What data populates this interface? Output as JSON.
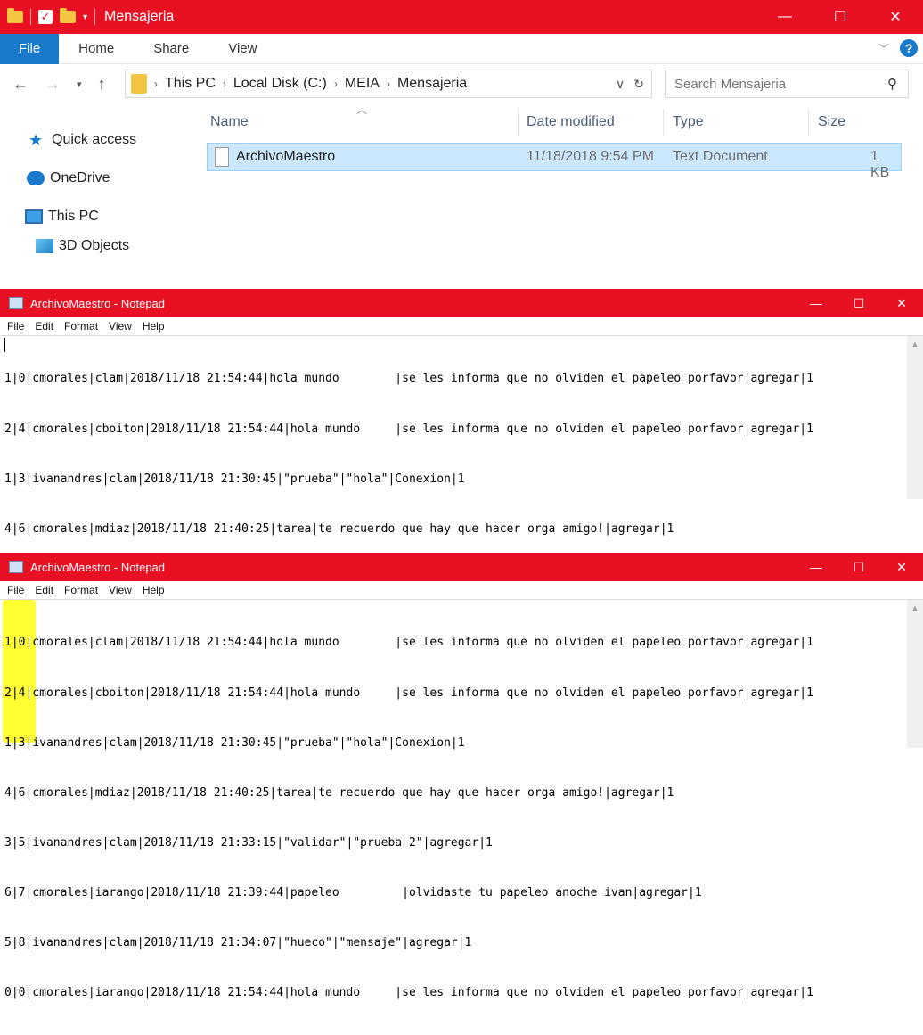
{
  "explorer": {
    "title": "Mensajeria",
    "window_controls": [
      "—",
      "☐",
      "✕"
    ],
    "ribbon_tabs": [
      "File",
      "Home",
      "Share",
      "View"
    ],
    "breadcrumb": [
      "This PC",
      "Local Disk (C:)",
      "MEIA",
      "Mensajeria"
    ],
    "search_placeholder": "Search Mensajeria",
    "nav": [
      "Quick access",
      "OneDrive",
      "This PC",
      "3D Objects"
    ],
    "columns": [
      "Name",
      "Date modified",
      "Type",
      "Size"
    ],
    "file": {
      "name": "ArchivoMaestro",
      "date": "11/18/2018 9:54 PM",
      "type": "Text Document",
      "size": "1 KB"
    }
  },
  "notepad": {
    "title": "ArchivoMaestro - Notepad",
    "menu": [
      "File",
      "Edit",
      "Format",
      "View",
      "Help"
    ],
    "lines": [
      "1|0|cmorales|clam|2018/11/18 21:54:44|hola mundo        |se les informa que no olviden el papeleo porfavor|agregar|1",
      "2|4|cmorales|cboiton|2018/11/18 21:54:44|hola mundo     |se les informa que no olviden el papeleo porfavor|agregar|1",
      "1|3|ivanandres|clam|2018/11/18 21:30:45|\"prueba\"|\"hola\"|Conexion|1",
      "4|6|cmorales|mdiaz|2018/11/18 21:40:25|tarea|te recuerdo que hay que hacer orga amigo!|agregar|1",
      "3|5|ivanandres|clam|2018/11/18 21:33:15|\"validar\"|\"prueba 2\"|agregar|1",
      "6|7|cmorales|iarango|2018/11/18 21:39:44|papeleo         |olvidaste tu papeleo anoche ivan|agregar|1",
      "5|8|ivanandres|clam|2018/11/18 21:34:07|\"hueco\"|\"mensaje\"|agregar|1",
      "0|0|cmorales|iarango|2018/11/18 21:54:44|hola mundo     |se les informa que no olviden el papeleo porfavor|agregar|1"
    ]
  }
}
